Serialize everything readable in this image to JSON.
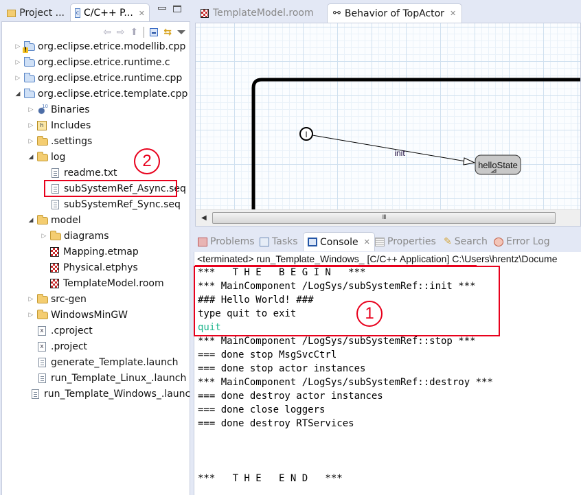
{
  "left_panel": {
    "tabs": [
      {
        "label": "Project ...",
        "active": false
      },
      {
        "label": "C/C++ P...",
        "active": true
      }
    ],
    "tree": [
      {
        "label": "org.eclipse.etrice.modellib.cpp",
        "level": 0,
        "icon": "project-warning-icon",
        "expanded": false
      },
      {
        "label": "org.eclipse.etrice.runtime.c",
        "level": 0,
        "icon": "project-icon",
        "expanded": false
      },
      {
        "label": "org.eclipse.etrice.runtime.cpp",
        "level": 0,
        "icon": "project-icon",
        "expanded": false
      },
      {
        "label": "org.eclipse.etrice.template.cpp",
        "level": 0,
        "icon": "project-icon",
        "expanded": true
      },
      {
        "label": "Binaries",
        "level": 1,
        "icon": "binaries-icon",
        "expanded": false
      },
      {
        "label": "Includes",
        "level": 1,
        "icon": "includes-icon",
        "expanded": false
      },
      {
        "label": ".settings",
        "level": 1,
        "icon": "folder-icon",
        "expanded": false
      },
      {
        "label": "log",
        "level": 1,
        "icon": "folder-icon",
        "expanded": true
      },
      {
        "label": "readme.txt",
        "level": 2,
        "icon": "text-file-icon"
      },
      {
        "label": "subSystemRef_Async.seq",
        "level": 2,
        "icon": "text-file-icon",
        "highlighted": true
      },
      {
        "label": "subSystemRef_Sync.seq",
        "level": 2,
        "icon": "text-file-icon"
      },
      {
        "label": "model",
        "level": 1,
        "icon": "folder-icon",
        "expanded": true
      },
      {
        "label": "diagrams",
        "level": 2,
        "icon": "folder-icon",
        "expanded": false
      },
      {
        "label": "Mapping.etmap",
        "level": 2,
        "icon": "etmap-file-icon"
      },
      {
        "label": "Physical.etphys",
        "level": 2,
        "icon": "etphys-file-icon"
      },
      {
        "label": "TemplateModel.room",
        "level": 2,
        "icon": "room-file-icon"
      },
      {
        "label": "src-gen",
        "level": 1,
        "icon": "folder-icon",
        "expanded": false
      },
      {
        "label": "WindowsMinGW",
        "level": 1,
        "icon": "folder-icon",
        "expanded": false
      },
      {
        "label": ".cproject",
        "level": 1,
        "icon": "xml-file-icon"
      },
      {
        "label": ".project",
        "level": 1,
        "icon": "xml-file-icon"
      },
      {
        "label": "generate_Template.launch",
        "level": 1,
        "icon": "text-file-icon"
      },
      {
        "label": "run_Template_Linux_.launch",
        "level": 1,
        "icon": "text-file-icon"
      },
      {
        "label": "run_Template_Windows_.launch",
        "level": 1,
        "icon": "text-file-icon"
      }
    ],
    "callout": "2"
  },
  "editor": {
    "tabs": [
      {
        "label": "TemplateModel.room",
        "active": false
      },
      {
        "label": "Behavior of TopActor",
        "active": true
      }
    ],
    "diagram": {
      "initial_point_label": "I",
      "transition_label": "init",
      "state_label": "helloState"
    },
    "scrollbar_grip": "III"
  },
  "console_view": {
    "tabs": [
      {
        "label": "Problems",
        "icon": "problems-icon",
        "active": false
      },
      {
        "label": "Tasks",
        "icon": "tasks-icon",
        "active": false
      },
      {
        "label": "Console",
        "icon": "console-icon",
        "active": true
      },
      {
        "label": "Properties",
        "icon": "properties-icon",
        "active": false
      },
      {
        "label": "Search",
        "icon": "search-icon",
        "active": false
      },
      {
        "label": "Error Log",
        "icon": "error-log-icon",
        "active": false
      }
    ],
    "status": "<terminated> run_Template_Windows_ [C/C++ Application] C:\\Users\\hrentz\\Docume",
    "output": [
      {
        "text": "***   T H E   B E G I N   ***",
        "type": "stdout"
      },
      {
        "text": "*** MainComponent /LogSys/subSystemRef::init ***",
        "type": "stdout"
      },
      {
        "text": "### Hello World! ###",
        "type": "stdout"
      },
      {
        "text": "type quit to exit",
        "type": "stdout"
      },
      {
        "text": "quit",
        "type": "stdin"
      },
      {
        "text": "*** MainComponent /LogSys/subSystemRef::stop ***",
        "type": "stdout"
      },
      {
        "text": "=== done stop MsgSvcCtrl",
        "type": "stdout"
      },
      {
        "text": "=== done stop actor instances",
        "type": "stdout"
      },
      {
        "text": "*** MainComponent /LogSys/subSystemRef::destroy ***",
        "type": "stdout"
      },
      {
        "text": "=== done destroy actor instances",
        "type": "stdout"
      },
      {
        "text": "=== done close loggers",
        "type": "stdout"
      },
      {
        "text": "=== done destroy RTServices",
        "type": "stdout"
      },
      {
        "text": "",
        "type": "stdout"
      },
      {
        "text": "",
        "type": "stdout"
      },
      {
        "text": "",
        "type": "stdout"
      },
      {
        "text": "***   T H E   E N D   ***",
        "type": "stdout"
      }
    ],
    "callout": "1"
  },
  "colors": {
    "annotation_red": "#e8001c",
    "stdin_green": "#18b38a",
    "state_fill": "#c8c8c8"
  }
}
